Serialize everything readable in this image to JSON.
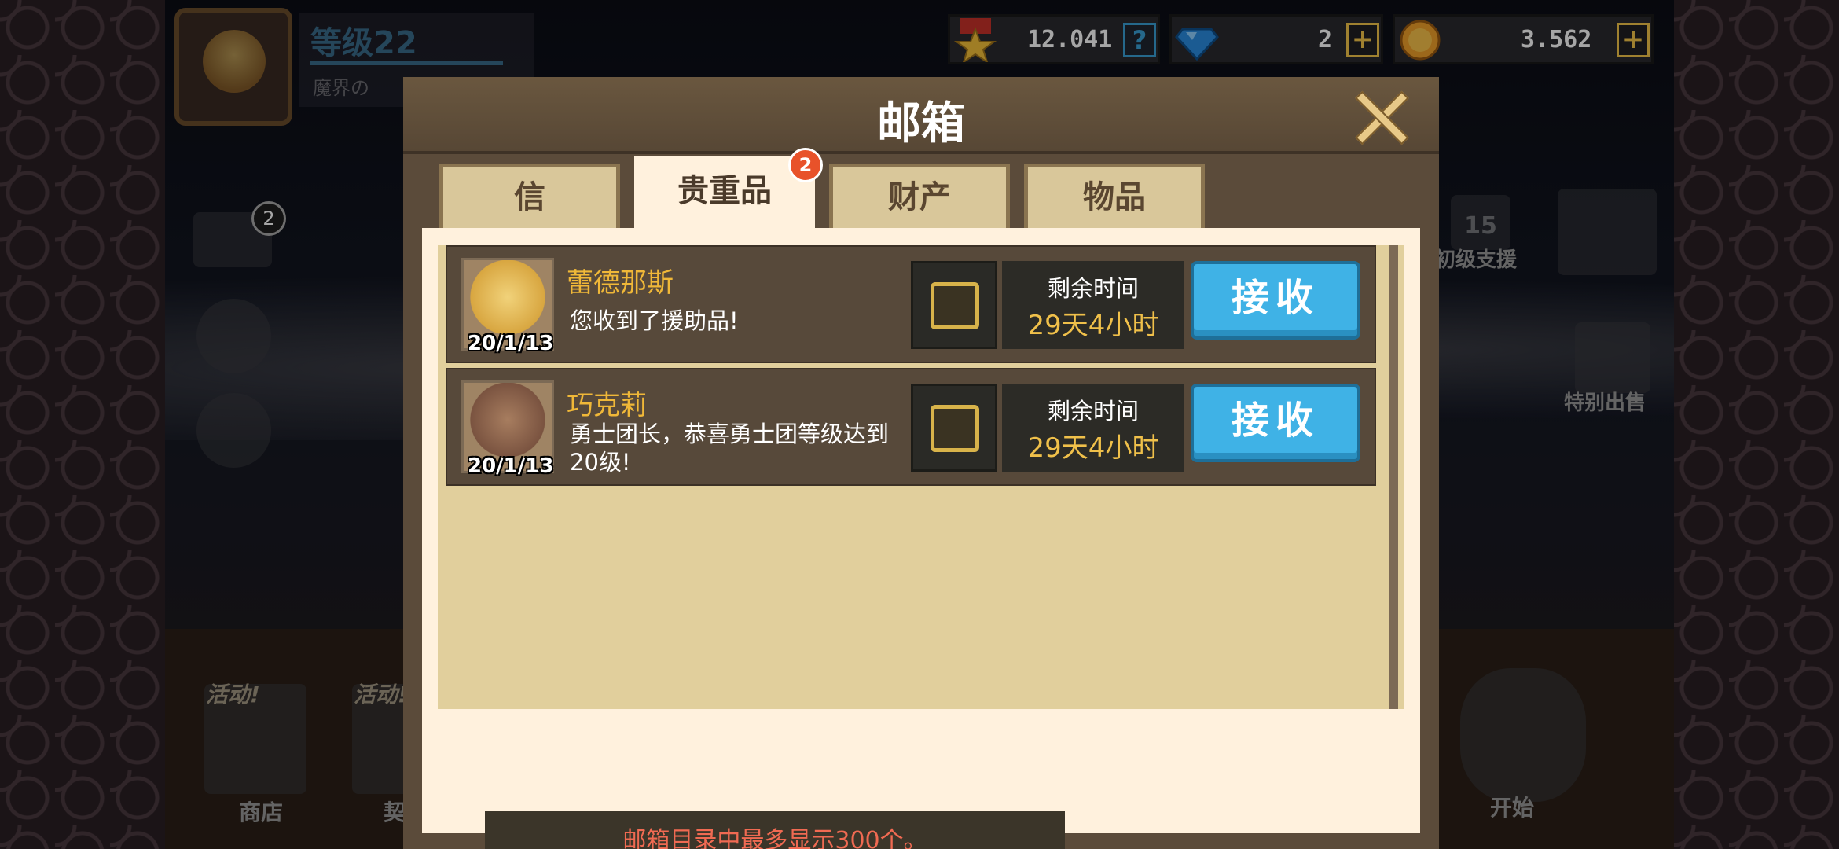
{
  "profile": {
    "level": "等级22",
    "world": "魔界の"
  },
  "currency": {
    "stamina": "12.041",
    "gems": "2",
    "gold": "3.562",
    "help_symbol": "?",
    "plus_symbol": "+"
  },
  "side": {
    "mail_badge": "2",
    "daily_support_day": "15",
    "daily_support_label": "初级支援",
    "special_sale_label": "特别出售",
    "shop_label": "商店",
    "contract_label": "契约",
    "start_label": "开始",
    "event_label_1": "活动!",
    "event_label_2": "活动!"
  },
  "modal": {
    "title": "邮箱",
    "tabs": [
      {
        "label": "信"
      },
      {
        "label": "贵重品",
        "badge": "2"
      },
      {
        "label": "财产"
      },
      {
        "label": "物品"
      }
    ],
    "mails": [
      {
        "sender": "蕾德那斯",
        "date": "20/1/13",
        "message": "您收到了援助品!",
        "time_label": "剩余时间",
        "time_value": "29天4小时",
        "button": "接收"
      },
      {
        "sender": "巧克莉",
        "date": "20/1/13",
        "message": "勇士团长，恭喜勇士团等级达到20级!",
        "time_label": "剩余时间",
        "time_value": "29天4小时",
        "button": "接收"
      }
    ],
    "notice": "邮箱目录中最多显示300个。"
  },
  "colors": {
    "accent_blue": "#3fb2e6",
    "gold_text": "#f0b838",
    "notice_red": "#f06a52",
    "badge_red": "#e8522a"
  }
}
